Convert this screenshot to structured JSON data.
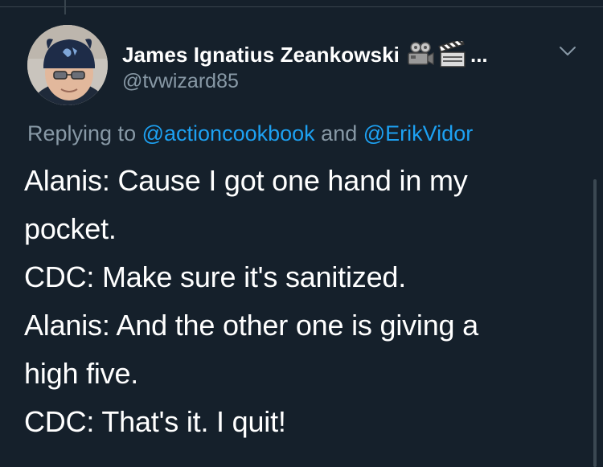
{
  "tweet": {
    "display_name": "James Ignatius Zeankowski",
    "name_emojis": [
      "movie-camera-icon",
      "clapper-board-icon"
    ],
    "name_truncation": "...",
    "handle": "@tvwizard85",
    "reply": {
      "prefix": "Replying to",
      "mentions": [
        "@actioncookbook",
        "@ErikVidor"
      ],
      "joiner": "and"
    },
    "body_lines": [
      "Alanis: Cause I got one hand in my",
      "pocket.",
      "CDC: Make sure it's sanitized.",
      "Alanis: And the other one is giving a",
      "high five.",
      "CDC: That's it. I quit!"
    ]
  },
  "colors": {
    "background": "#15202b",
    "text": "#ffffff",
    "secondary_text": "#8899a6",
    "link": "#1da1f2",
    "divider": "#38444d"
  }
}
